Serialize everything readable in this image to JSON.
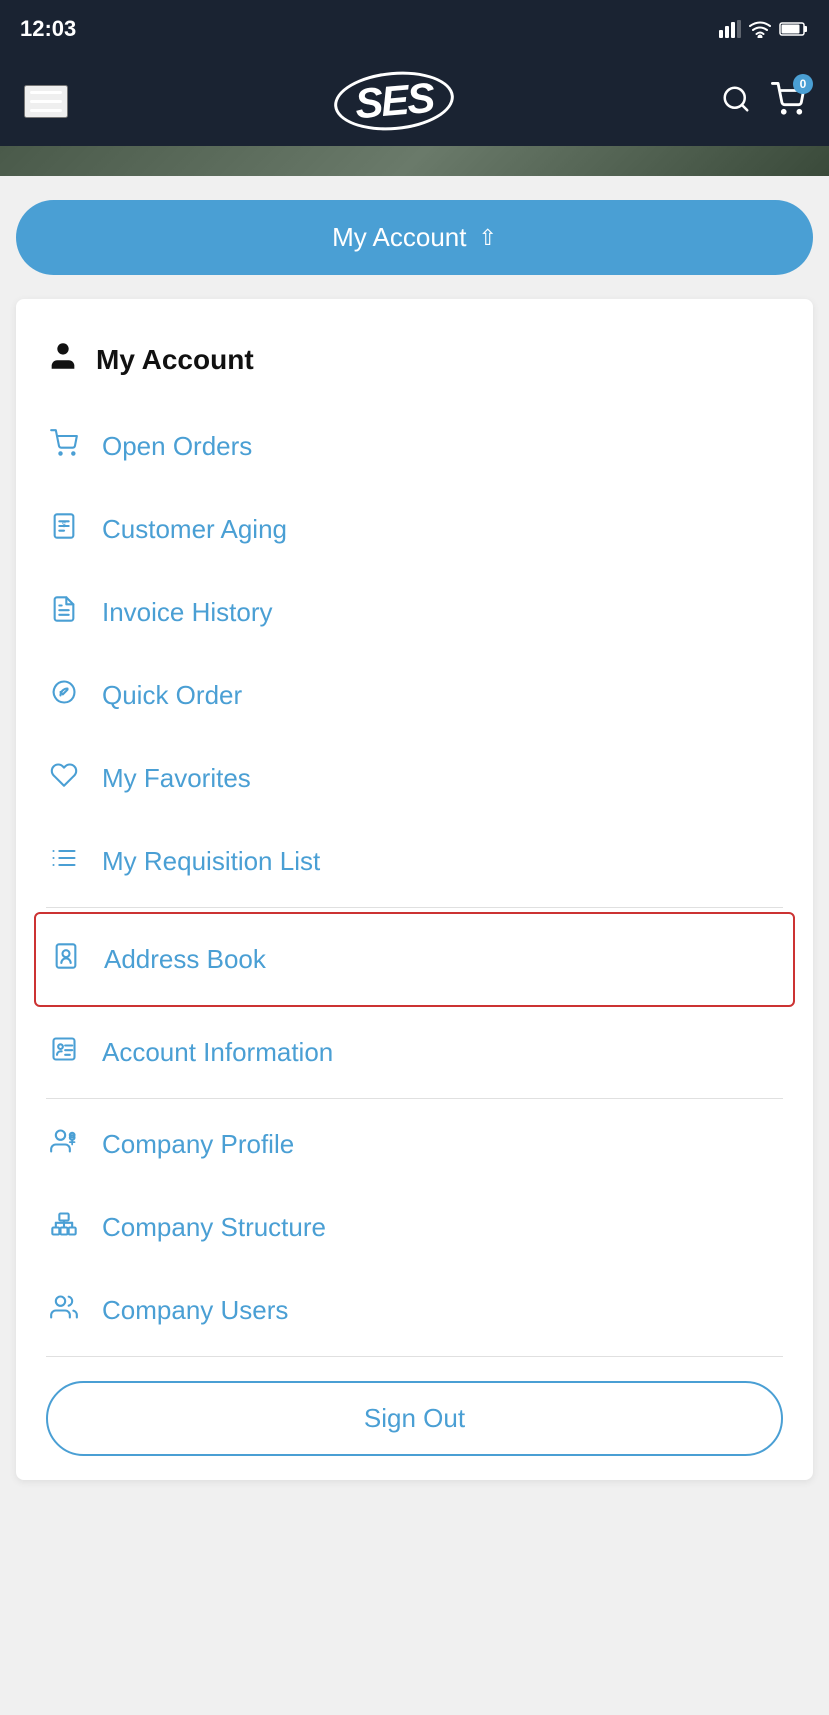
{
  "statusBar": {
    "time": "12:03",
    "cartBadge": "0"
  },
  "header": {
    "logoText": "SES",
    "menuLabel": "Menu",
    "searchLabel": "Search",
    "cartLabel": "Cart"
  },
  "myAccountButton": {
    "label": "My Account",
    "chevron": "^"
  },
  "accountMenu": {
    "headerLabel": "My Account",
    "items": [
      {
        "id": "open-orders",
        "label": "Open Orders",
        "icon": "cart"
      },
      {
        "id": "customer-aging",
        "label": "Customer Aging",
        "icon": "document-dollar"
      },
      {
        "id": "invoice-history",
        "label": "Invoice History",
        "icon": "invoice"
      },
      {
        "id": "quick-order",
        "label": "Quick Order",
        "icon": "quick-order"
      },
      {
        "id": "my-favorites",
        "label": "My Favorites",
        "icon": "heart"
      },
      {
        "id": "my-requisition-list",
        "label": "My Requisition List",
        "icon": "list"
      }
    ],
    "section2": [
      {
        "id": "address-book",
        "label": "Address Book",
        "icon": "address-book",
        "highlighted": true
      },
      {
        "id": "account-information",
        "label": "Account Information",
        "icon": "account-info"
      }
    ],
    "section3": [
      {
        "id": "company-profile",
        "label": "Company Profile",
        "icon": "company-profile"
      },
      {
        "id": "company-structure",
        "label": "Company Structure",
        "icon": "company-structure"
      },
      {
        "id": "company-users",
        "label": "Company Users",
        "icon": "company-users"
      }
    ],
    "signOutLabel": "Sign Out"
  }
}
